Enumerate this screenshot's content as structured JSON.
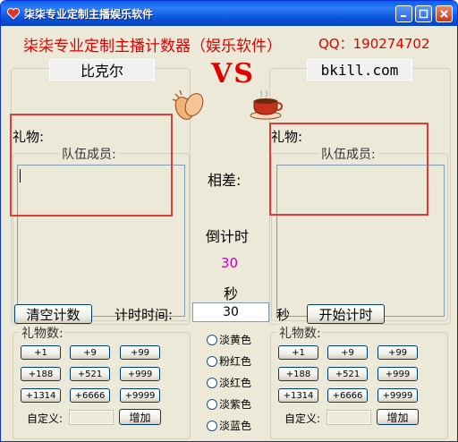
{
  "window": {
    "title": "柒柒专业定制主播娱乐软件"
  },
  "header": {
    "headline": "柒柒专业定制主播计数器（娱乐软件）",
    "qq": "QQ：190274702",
    "vs": "VS"
  },
  "left_team": {
    "name": "比克尔",
    "gift_label": "礼物:",
    "members_title": "队伍成员:",
    "members_text": ""
  },
  "right_team": {
    "name": "bkill.com",
    "gift_label": "礼物:",
    "members_title": "队伍成员:",
    "members_text": ""
  },
  "center": {
    "diff_label": "相差:",
    "countdown_label": "倒计时",
    "countdown_value": "30",
    "seconds_label": "秒"
  },
  "controls": {
    "clear_label": "清空计数",
    "timer_label": "计时时间:",
    "timer_value": "30",
    "timer_unit": "秒",
    "start_label": "开始计时"
  },
  "gift_counts": {
    "title": "礼物数:",
    "buttons": [
      "+1",
      "+9",
      "+99",
      "+188",
      "+521",
      "+999",
      "+1314",
      "+6666",
      "+9999"
    ],
    "custom_label": "自定义:",
    "add_label": "增加"
  },
  "colors": {
    "options": [
      "淡黄色",
      "粉红色",
      "淡红色",
      "淡紫色",
      "淡蓝色"
    ],
    "selected": null
  },
  "theme": {
    "accent_red": "#e00000",
    "countdown_color": "#c000c0",
    "highlight_box": "#e63a3a"
  }
}
